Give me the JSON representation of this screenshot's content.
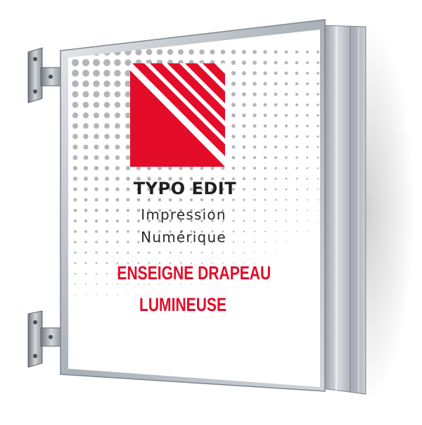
{
  "sign": {
    "brand": "TYPO EDIT",
    "tagline_line1": "Impression",
    "tagline_line2": "Numérique",
    "headline_line1": "ENSEIGNE DRAPEAU",
    "headline_line2": "LUMINEUSE"
  },
  "colors": {
    "accent_red": "#e30d2a",
    "frame_metal": "#b9bec4",
    "dots": "#9c9c9c",
    "panel": "#ffffff"
  },
  "icons": {
    "logo": "red-triangle-logo-icon",
    "bracket": "wall-bracket-icon"
  }
}
